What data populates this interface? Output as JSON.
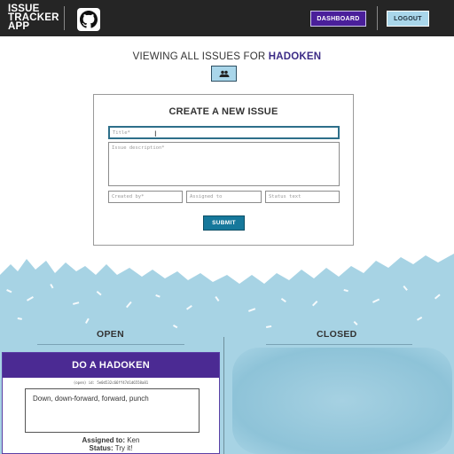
{
  "header": {
    "brand_line1": "ISSUE",
    "brand_line2": "TRACKER",
    "brand_line3": "APP",
    "github_icon": "github-icon",
    "dashboard_label": "DASHBOARD",
    "logout_label": "LOGOUT"
  },
  "project": {
    "viewing_prefix": "VIEWING ALL ISSUES FOR",
    "name": "HADOKEN",
    "users_icon": "users-icon"
  },
  "form": {
    "title": "CREATE A NEW ISSUE",
    "title_placeholder": "Title*",
    "description_placeholder": "Issue description*",
    "created_by_placeholder": "Created by*",
    "assigned_to_placeholder": "Assigned to",
    "status_placeholder": "Status text",
    "submit_label": "SUBMIT"
  },
  "columns": {
    "open_label": "OPEN",
    "closed_label": "CLOSED"
  },
  "issues_open": [
    {
      "title": "DO A HADOKEN",
      "id_text": "(open) id: 5e0d532c66ff47d1d6558a81",
      "description": "Down, down-forward, forward, punch",
      "assigned_label": "Assigned to:",
      "assigned_value": "Ken",
      "status_label": "Status:",
      "status_value": "Try it!"
    }
  ],
  "colors": {
    "topbar": "#252525",
    "dashboard_bg": "#4a1f9a",
    "logout_bg": "#a9d6ea",
    "accent_purple": "#4b2a93",
    "submit_bg": "#16789b",
    "wave_bg": "#a6d1e2"
  }
}
